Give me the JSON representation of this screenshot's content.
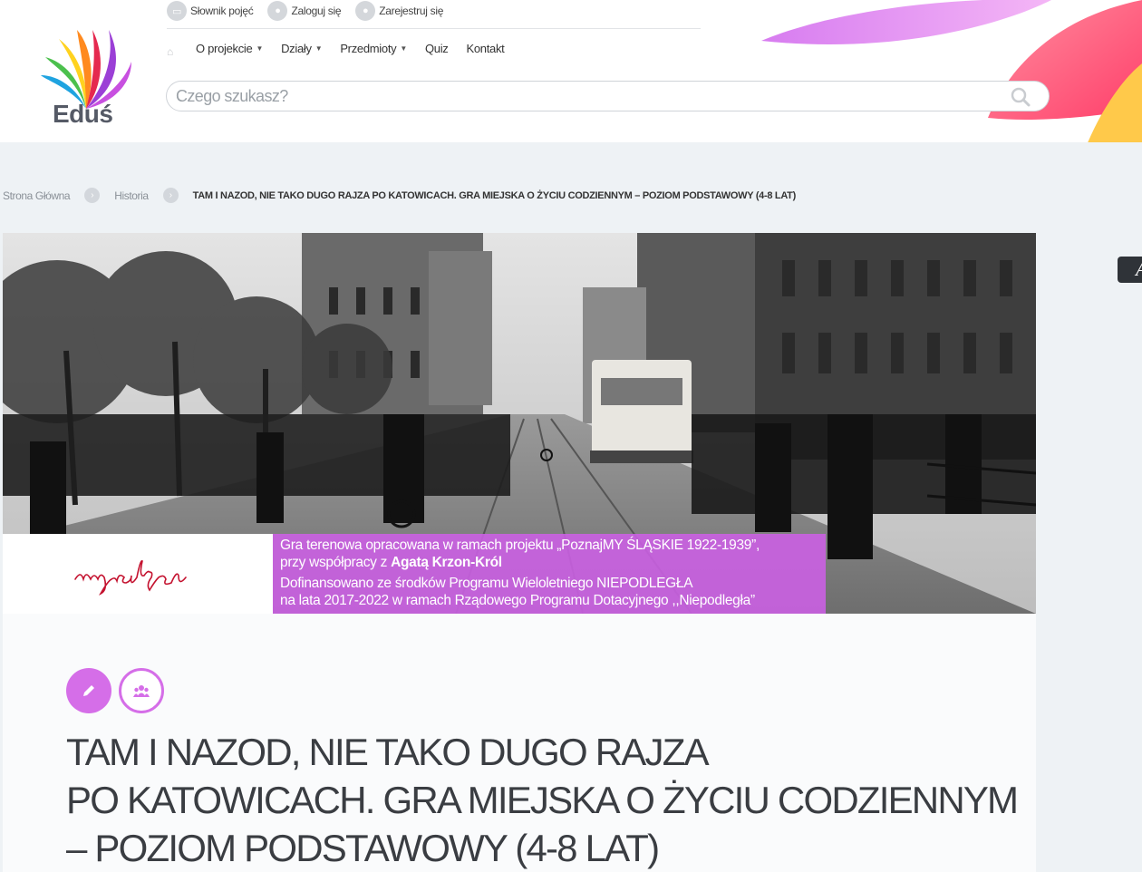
{
  "header": {
    "logo_text": "Eduś",
    "top_links": [
      {
        "label": "Słownik pojęć",
        "icon": "book-icon"
      },
      {
        "label": "Zaloguj się",
        "icon": "user-icon"
      },
      {
        "label": "Zarejestruj się",
        "icon": "user-icon"
      }
    ],
    "nav": [
      {
        "label": "O projekcie",
        "dropdown": true
      },
      {
        "label": "Działy",
        "dropdown": true
      },
      {
        "label": "Przedmioty",
        "dropdown": true
      },
      {
        "label": "Quiz",
        "dropdown": false
      },
      {
        "label": "Kontakt",
        "dropdown": false
      }
    ],
    "search": {
      "placeholder": "Czego szukasz?",
      "value": ""
    }
  },
  "breadcrumb": {
    "items": [
      "Strona Główna",
      "Historia"
    ],
    "current": "TAM I NAZOD, NIE TAKO DUGO RAJZA PO KATOWICACH. GRA MIEJSKA O ŻYCIU CODZIENNYM – POZIOM PODSTAWOWY (4-8 LAT)"
  },
  "hero": {
    "caption_lines": [
      "Gra terenowa opracowana w ramach projektu „PoznajMY ŚLĄSKIE 1922-1939”,",
      "przy współpracy z ",
      "Dofinansowano ze środków Programu Wieloletniego NIEPODLEGŁA",
      "na lata 2017-2022 w ramach Rządowego Programu  Dotacyjnego ,,Niepodległa”"
    ],
    "caption_author": "Agatą Krzon-Król",
    "signature_text": "niepodległa",
    "photo_alt": "Archival black-and-white street scene in Katowice with a tram and crowds"
  },
  "side_tab": {
    "label": "A"
  },
  "content": {
    "badges": [
      {
        "icon": "pencil-icon",
        "style": "filled"
      },
      {
        "icon": "group-icon",
        "style": "outline"
      }
    ],
    "title_lines": [
      "TAM I NAZOD, NIE TAKO DUGO RAJZA",
      "PO KATOWICACH. GRA MIEJSKA O ŻYCIU CODZIENNYM",
      "– POZIOM PODSTAWOWY (4-8 LAT)"
    ]
  },
  "colors": {
    "accent": "#d56ee8",
    "text": "#3a3d42",
    "background": "#eef2f5"
  }
}
